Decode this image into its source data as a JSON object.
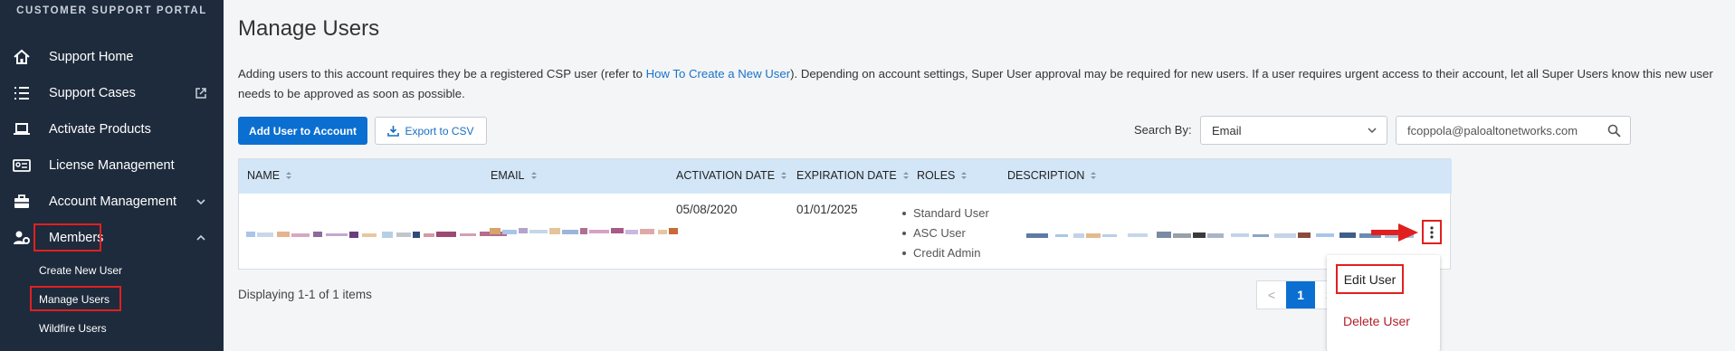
{
  "sidebar": {
    "brand": "CUSTOMER SUPPORT PORTAL",
    "items": [
      {
        "label": "Support Home",
        "icon": "home-icon"
      },
      {
        "label": "Support Cases",
        "icon": "list-icon",
        "trailing": "external-link-icon"
      },
      {
        "label": "Activate Products",
        "icon": "laptop-icon"
      },
      {
        "label": "License Management",
        "icon": "license-icon"
      },
      {
        "label": "Account Management",
        "icon": "briefcase-icon",
        "trailing": "chevron-down-icon"
      },
      {
        "label": "Members",
        "icon": "users-gear-icon",
        "trailing": "chevron-up-icon"
      }
    ],
    "sub_items": [
      "Create New User",
      "Manage Users",
      "Wildfire Users"
    ]
  },
  "page": {
    "title": "Manage Users",
    "info_before_link": "Adding users to this account requires they be a registered CSP user (refer to ",
    "info_link": "How To Create a New User",
    "info_after_link": "). Depending on account settings, Super User approval may be required for new users. If a user requires urgent access to their account, let all Super Users know this new user needs to be approved as soon as possible."
  },
  "toolbar": {
    "add_user_label": "Add User to Account",
    "export_label": "Export to CSV",
    "search_by_label": "Search By:",
    "search_by_value": "Email",
    "search_value": "fcoppola@paloaltonetworks.com"
  },
  "table": {
    "columns": [
      "NAME",
      "EMAIL",
      "ACTIVATION DATE",
      "EXPIRATION DATE",
      "ROLES",
      "DESCRIPTION"
    ],
    "rows": [
      {
        "activation_date": "05/08/2020",
        "expiration_date": "01/01/2025",
        "roles": [
          "Standard User",
          "ASC User",
          "Credit Admin"
        ]
      }
    ]
  },
  "pagination": {
    "summary": "Displaying 1-1 of 1 items",
    "current_page": "1",
    "prev": "<",
    "next": ">"
  },
  "row_menu": {
    "edit_label": "Edit User",
    "delete_label": "Delete User"
  },
  "colors": {
    "sidebar_bg": "#1e2b3c",
    "primary": "#0b6fd1",
    "table_header_bg": "#d3e6f8",
    "highlight": "#e02020",
    "delete_text": "#b0202a"
  }
}
